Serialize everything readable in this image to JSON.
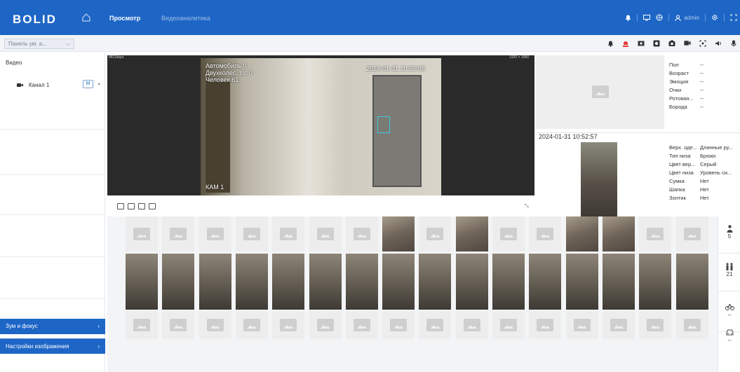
{
  "header": {
    "logo_text": "BOLID",
    "tabs": [
      {
        "label": "Просмотр",
        "active": true
      },
      {
        "label": "Видеоаналитика",
        "active": false
      }
    ],
    "user": "admin"
  },
  "toolbar": {
    "panel_select": "Панель ум. а..."
  },
  "sidebar": {
    "section_label": "Видео",
    "channel_label": "Канал 1",
    "channel_badge": "M",
    "buttons": [
      {
        "label": "Зум и фокус"
      },
      {
        "label": "Настройки изображения"
      }
    ]
  },
  "video": {
    "bitrate": "4811kbps",
    "resolution": "1920 × 1080",
    "overlay_lines": [
      "Автомобиль 0",
      "Двухколес. т/с 0",
      "Человек 61"
    ],
    "timestamp": "2024-01-31 10:53:08",
    "camera_label": "КАМ 1"
  },
  "face_attributes": [
    {
      "key": "Пол",
      "value": "--"
    },
    {
      "key": "Возраст",
      "value": "--"
    },
    {
      "key": "Эмоция",
      "value": "--"
    },
    {
      "key": "Очки",
      "value": "--"
    },
    {
      "key": "Ротовая...",
      "value": "--"
    },
    {
      "key": "Борода",
      "value": "--"
    }
  ],
  "event_time": "2024-01-31 10:52:57",
  "body_attributes": [
    {
      "key": "Верх. оде...",
      "value": "Длинные ру..."
    },
    {
      "key": "Тип низа",
      "value": "Брюки"
    },
    {
      "key": "Цвет вер...",
      "value": "Серый"
    },
    {
      "key": "Цвет низа",
      "value": "Уровень си..."
    },
    {
      "key": "Сумка",
      "value": "Нет"
    },
    {
      "key": "Шапка",
      "value": "Нет"
    },
    {
      "key": "Зонтик",
      "value": "Нет"
    }
  ],
  "counters": [
    {
      "icon": "person-icon",
      "value": "5"
    },
    {
      "icon": "people-icon",
      "value": "21"
    },
    {
      "icon": "bicycle-icon",
      "value": "--"
    },
    {
      "icon": "car-icon",
      "value": "--"
    }
  ],
  "gallery_rows": [
    [
      "ph",
      "ph",
      "ph",
      "ph",
      "ph",
      "ph",
      "ph",
      "face",
      "ph",
      "face",
      "ph",
      "ph",
      "face",
      "face",
      "ph",
      "ph"
    ],
    [
      "photo",
      "photo",
      "photo",
      "photo",
      "photo",
      "photo",
      "photo",
      "photo",
      "photo",
      "photo",
      "photo",
      "photo",
      "photo",
      "photo",
      "photo",
      "photo"
    ],
    [
      "ph",
      "ph",
      "ph",
      "ph",
      "ph",
      "ph",
      "ph",
      "ph",
      "ph",
      "ph",
      "ph",
      "ph",
      "ph",
      "ph",
      "ph",
      "ph"
    ]
  ],
  "colors": {
    "primary": "#1e66c6",
    "alarm": "#e53935",
    "bbox": "#3cc8e0"
  }
}
